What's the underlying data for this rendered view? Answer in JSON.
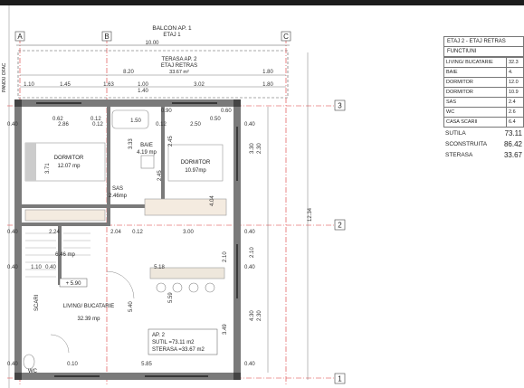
{
  "grid": {
    "cols": [
      "A",
      "B",
      "C"
    ],
    "rows": [
      "3",
      "2",
      "1"
    ]
  },
  "balcony": {
    "title": "BALCON AP. 1",
    "subtitle": "ETAJ 1"
  },
  "terrace": {
    "title": "TERASA AP. 2",
    "subtitle": "ETAJ RETRAS",
    "area": "33.67 m²"
  },
  "rooms": {
    "dormitor1": {
      "name": "DORMITOR",
      "area": "12.07 mp"
    },
    "baie": {
      "name": "BAIE",
      "area": "4.19 mp"
    },
    "dormitor2": {
      "name": "DORMITOR",
      "area": "10.97mp"
    },
    "sas": {
      "name": "SAS",
      "area": "2.46mp"
    },
    "living": {
      "name": "LIVING/ BUCATARIE",
      "area": "32.39 mp"
    },
    "stairs": {
      "area": "6.46 mp"
    },
    "scari": {
      "name": "SCARI"
    },
    "wc": {
      "name": "WC"
    },
    "pangou": {
      "name": "PANOU OFAC"
    }
  },
  "level_mark": "+ 5.90",
  "apartment_box": {
    "title": "AP. 2",
    "s_util": "SUTIL =73.11 m2",
    "s_terasa": "STERASA =33.67 m2"
  },
  "dimensions": {
    "total_width": "10.00",
    "terrace_row": [
      "8.20",
      "1.80"
    ],
    "terrace_detail": [
      "1.10",
      "1.45",
      "1.63",
      "1.00",
      "3.02",
      "1.80"
    ],
    "terrace_sub": "1.40",
    "wall_row_upper": [
      "0.40",
      "2.86",
      "0.12",
      "1.50",
      "0.12",
      "2.50",
      "0.40"
    ],
    "wall_row_mid": [
      "0.40",
      "2.24",
      "2.04",
      "0.12",
      "3.00",
      "0.40"
    ],
    "wall_row_lower": [
      "0.40",
      "1.10",
      "0.40",
      "5.18",
      "0.40"
    ],
    "wall_row_bottom": [
      "0.40",
      "0.10",
      "5.85",
      "0.40"
    ],
    "right_vertical": [
      "3.30",
      "2.30",
      "2.10",
      "4.30",
      "3.49",
      "2.30"
    ],
    "total_height": "12.34",
    "interior_vertical": [
      "5.40",
      "5.59",
      "2.45",
      "2.45",
      "3.33",
      "4.04",
      "3.71",
      "2.10"
    ],
    "misc": [
      "0.62",
      "0.12",
      "0.50",
      "0.90",
      "0.60"
    ]
  },
  "schedule": {
    "title": "ETAJ 2 - ETAJ RETRAS",
    "subtitle": "FUNCTIUNI",
    "rows": [
      {
        "label": "LIVING/ BUCATARIE",
        "value": "32.3"
      },
      {
        "label": "BAIE",
        "value": "4."
      },
      {
        "label": "DORMITOR",
        "value": "12.0"
      },
      {
        "label": "DORMITOR",
        "value": "10.9"
      },
      {
        "label": "SAS",
        "value": "2.4"
      },
      {
        "label": "WC",
        "value": "2.6"
      },
      {
        "label": "CASA SCARII",
        "value": "6.4"
      }
    ],
    "totals": [
      {
        "label": "SUTILA",
        "value": "73.11"
      },
      {
        "label": "SCONSTRUITA",
        "value": "86.42"
      },
      {
        "label": "STERASA",
        "value": "33.67"
      }
    ]
  },
  "colors": {
    "wall": "#7a7a7a",
    "grid": "#d33",
    "dim": "#333",
    "furniture": "#9a9a9a"
  }
}
